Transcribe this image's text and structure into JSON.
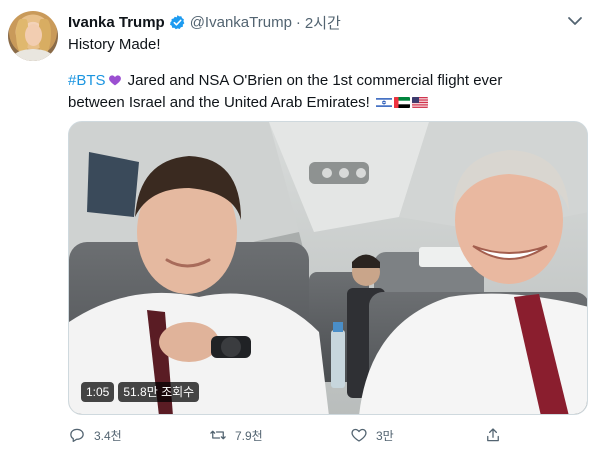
{
  "author": {
    "display_name": "Ivanka Trump",
    "handle": "@IvankaTrump",
    "separator": "·",
    "time": "2시간"
  },
  "tweet": {
    "line1": "History Made!",
    "hashtag": "#BTS",
    "text_a": " Jared and NSA O'Brien on the 1st commercial flight ever",
    "text_b": "between Israel and the United Arab  Emirates!"
  },
  "video": {
    "duration": "1:05",
    "views": "51.8만 조회수"
  },
  "actions": {
    "replies": "3.4천",
    "retweets": "7.9천",
    "likes": "3만"
  },
  "colors": {
    "hashtag": "#1b95e0",
    "verified": "#1d9bf0",
    "muted": "#536471",
    "heart": "#9b4fd1"
  },
  "icons": [
    "verified-badge-icon",
    "chevron-down-icon",
    "purple-heart-icon",
    "israel-flag-icon",
    "uae-flag-icon",
    "us-flag-icon",
    "reply-icon",
    "retweet-icon",
    "like-icon",
    "share-icon"
  ]
}
